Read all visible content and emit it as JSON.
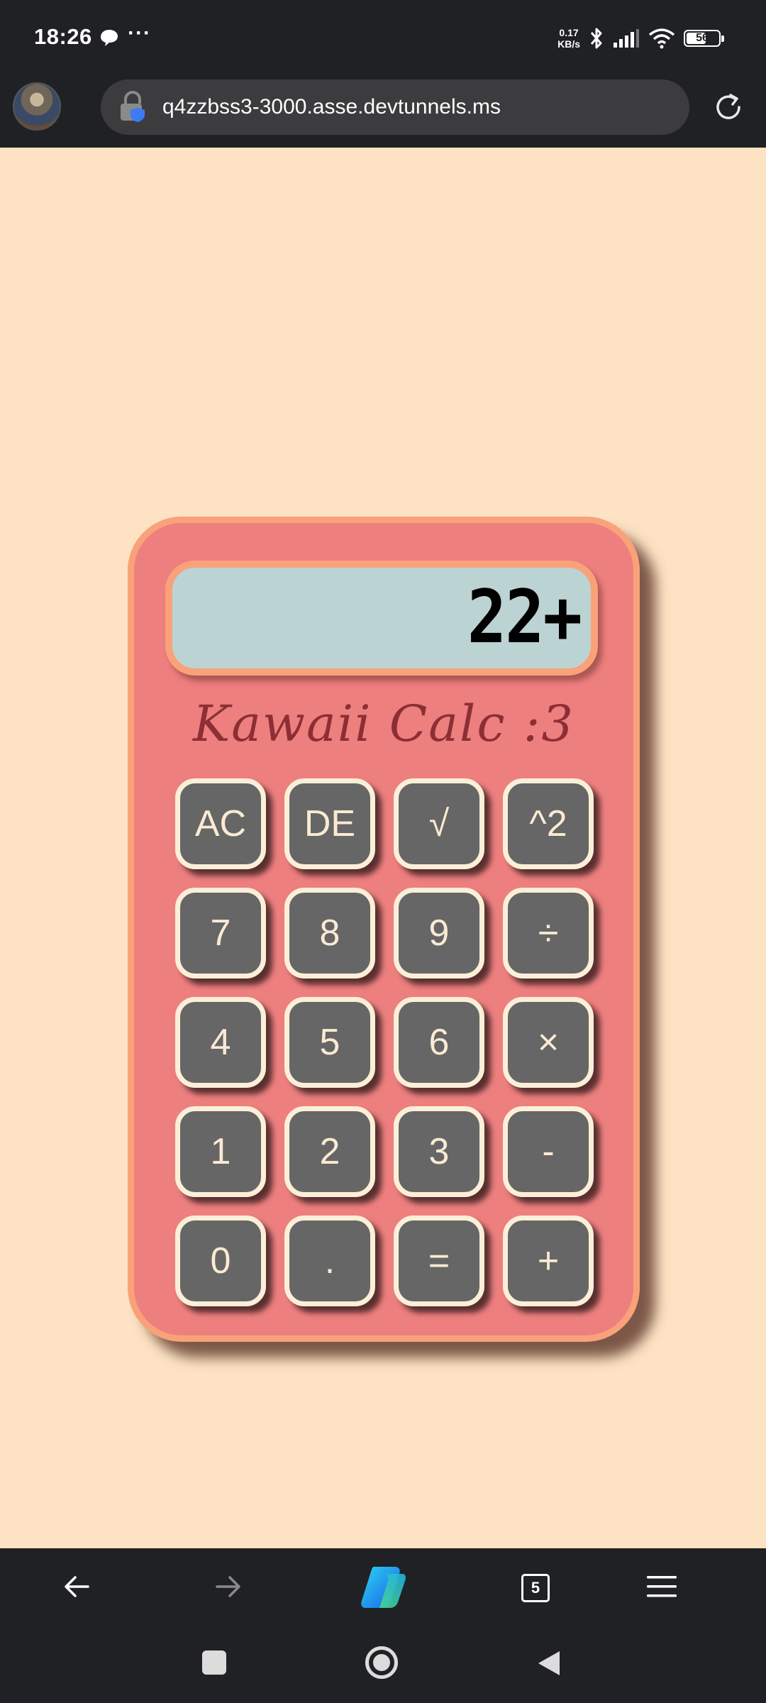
{
  "status_bar": {
    "time": "18:26",
    "more_indicator": "···",
    "net_speed_value": "0.17",
    "net_speed_unit": "KB/s",
    "battery_level": "56",
    "battery_fraction": 0.56
  },
  "browser": {
    "url": "q4zzbss3-3000.asse.devtunnels.ms",
    "tab_count": "5"
  },
  "calculator": {
    "title": "Kawaii Calc :3",
    "display_value": "22+",
    "keys": [
      "AC",
      "DE",
      "√",
      "^2",
      "7",
      "8",
      "9",
      "÷",
      "4",
      "5",
      "6",
      "×",
      "1",
      "2",
      "3",
      "-",
      "0",
      ".",
      "=",
      "+"
    ]
  },
  "colors": {
    "page_background": "#fde3c3",
    "calculator_body": "#ee7f7f",
    "calculator_border": "#f9a279",
    "display_background": "#bcd3d4",
    "key_background": "#666666",
    "key_border": "#fcefd8",
    "title_color": "#8c2f35"
  }
}
